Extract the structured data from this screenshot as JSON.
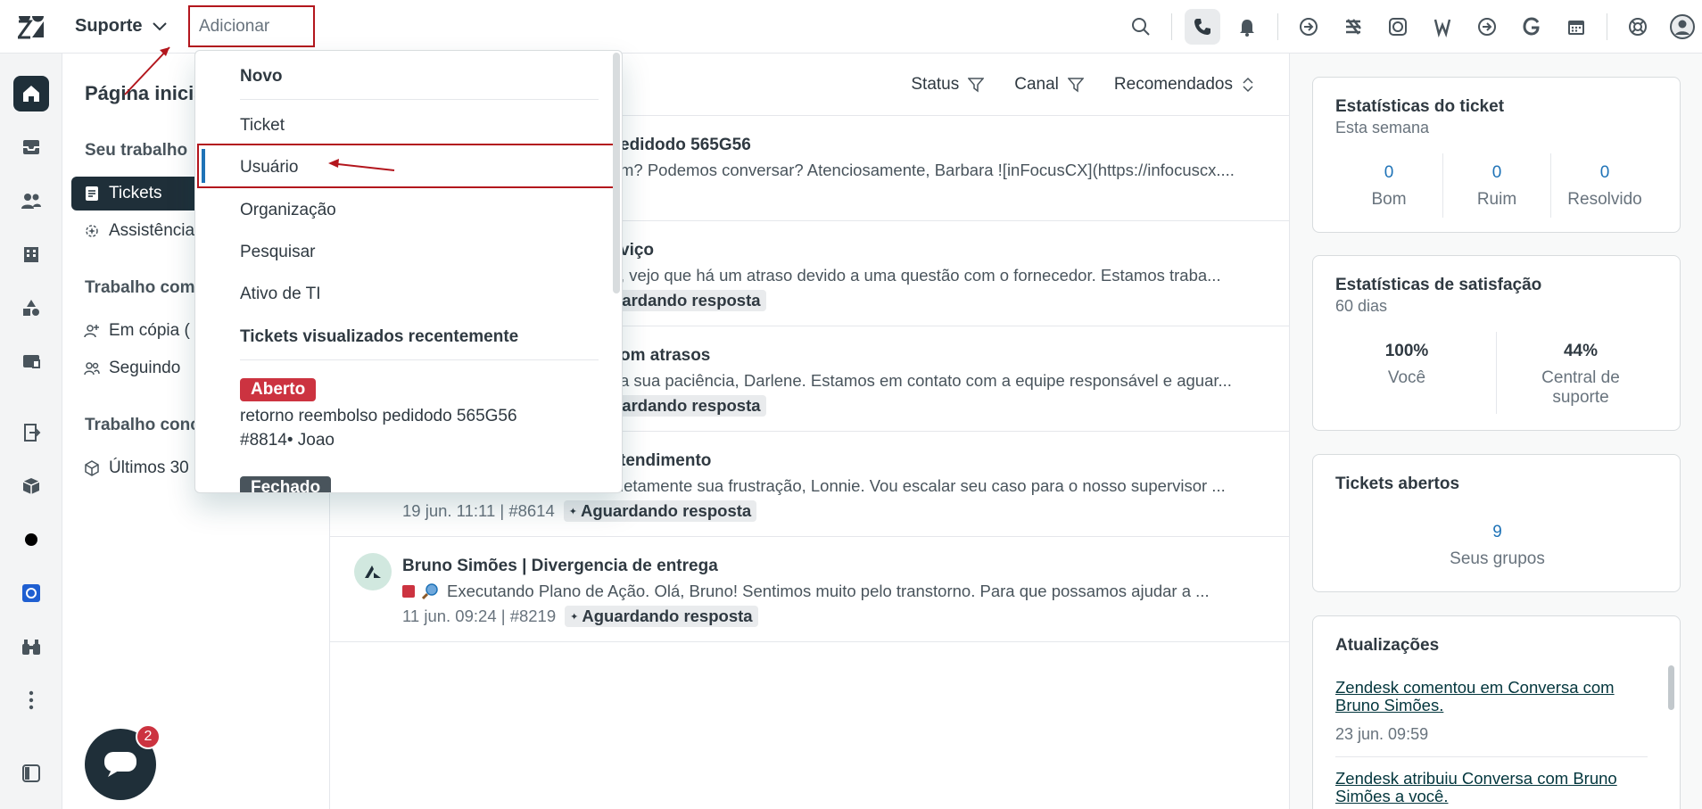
{
  "topbar": {
    "product": "Suporte",
    "add_placeholder": "Adicionar"
  },
  "leftnav": {
    "title": "Página inicial",
    "sections": [
      {
        "label": "Seu trabalho"
      },
      {
        "label": "Trabalho com"
      },
      {
        "label": "Trabalho conc"
      }
    ],
    "items": [
      {
        "label": "Tickets"
      },
      {
        "label": "Assistência"
      },
      {
        "label": "Em cópia ("
      },
      {
        "label": "Seguindo"
      },
      {
        "label": "Últimos 30"
      }
    ]
  },
  "chat": {
    "badge": "2"
  },
  "list": {
    "filters": [
      {
        "label": "Status"
      },
      {
        "label": "Canal"
      },
      {
        "label": "Recomendados"
      }
    ],
    "rows": [
      {
        "subject": "edidodo 565G56",
        "preview": "m? Podemos conversar? Atenciosamente, Barbara ![inFocusCX](https://infocuscx....",
        "meta": "",
        "status": ""
      },
      {
        "subject": "viço",
        "preview": ", vejo que há um atraso devido a uma questão com o fornecedor. Estamos traba...",
        "meta": "",
        "status": "uardando resposta"
      },
      {
        "subject": "om atrasos",
        "preview": "a sua paciência, Darlene. Estamos em contato com a equipe responsável e aguar...",
        "meta": "",
        "status": "uardando resposta"
      },
      {
        "subject": "tendimento",
        "preview": "letamente sua frustração, Lonnie. Vou escalar seu caso para o nosso supervisor ...",
        "meta": "19 jun. 11:11 | #8614",
        "status": "Aguardando resposta"
      },
      {
        "subject": "Bruno Simões | Divergencia de entrega",
        "preview": "Executando Plano de Ação.  Olá, Bruno! Sentimos muito pelo transtorno. Para que possamos ajudar a ...",
        "meta": "11 jun. 09:24 | #8219",
        "status": "Aguardando resposta"
      }
    ]
  },
  "right": {
    "ticket_stats": {
      "title": "Estatísticas do ticket",
      "subtitle": "Esta semana",
      "stats": [
        {
          "value": "0",
          "label": "Bom"
        },
        {
          "value": "0",
          "label": "Ruim"
        },
        {
          "value": "0",
          "label": "Resolvido"
        }
      ]
    },
    "satisfaction": {
      "title": "Estatísticas de satisfação",
      "subtitle": "60 dias",
      "you_value": "100%",
      "you_label": "Você",
      "central_value": "44%",
      "central_label_1": "Central de",
      "central_label_2": "suporte"
    },
    "open_tickets": {
      "title": "Tickets abertos",
      "value": "9",
      "label": "Seus grupos"
    },
    "updates": {
      "title": "Atualizações",
      "items": [
        {
          "link": "Zendesk comentou em Conversa com Bruno Simões.",
          "date": "23 jun. 09:59"
        },
        {
          "link": "Zendesk atribuiu Conversa com Bruno Simões a você.",
          "date": ""
        }
      ]
    }
  },
  "dropdown": {
    "new_title": "Novo",
    "items": [
      {
        "label": "Ticket"
      },
      {
        "label": "Usuário"
      },
      {
        "label": "Organização"
      },
      {
        "label": "Pesquisar"
      },
      {
        "label": "Ativo de TI"
      }
    ],
    "recent_title": "Tickets visualizados recentemente",
    "recent": [
      {
        "status": "Aberto",
        "line1": "retorno reembolso pedidodo 565G56",
        "line2": "#8814• Joao"
      },
      {
        "status": "Fechado"
      }
    ]
  },
  "colors": {
    "accent": "#1f73b7",
    "annotation": "#b3161d",
    "badge_open": "#cc3340",
    "badge_closed": "#49545c",
    "nav_active": "#1f2f39"
  },
  "icons": [
    "zendesk-logo",
    "chevron-down-icon",
    "search-icon",
    "phone-icon",
    "bell-icon",
    "arrow-in-icon",
    "grid-icon",
    "whatsapp-icon",
    "w-icon",
    "g-icon",
    "calendar-icon",
    "lifebuoy-icon",
    "avatar-icon",
    "home-icon",
    "inbox-icon",
    "users-icon",
    "building-icon",
    "shapes-icon",
    "tickets-icon",
    "box-icon",
    "filter-icon",
    "sort-icon",
    "chat-icon"
  ]
}
